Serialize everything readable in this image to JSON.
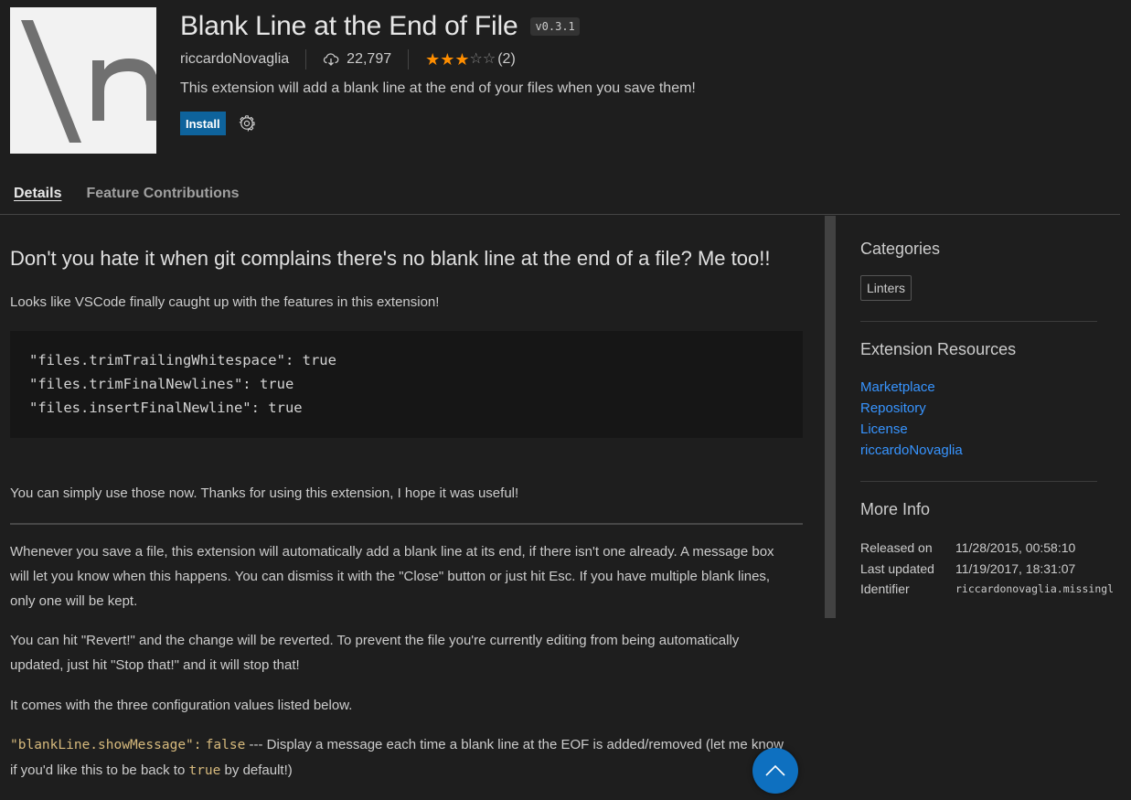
{
  "header": {
    "icon_text": "\\n",
    "title": "Blank Line at the End of File",
    "version": "v0.3.1",
    "publisher": "riccardoNovaglia",
    "install_count": "22,797",
    "rating": {
      "value": 3,
      "max": 5,
      "count_label": "(2)"
    },
    "description": "This extension will add a blank line at the end of your files when you save them!",
    "install_label": "Install",
    "icons": {
      "installs": "cloud-download-icon",
      "settings": "gear-icon",
      "star_full": "★",
      "star_empty": "☆"
    }
  },
  "tabs": [
    {
      "label": "Details",
      "active": true
    },
    {
      "label": "Feature Contributions",
      "active": false
    }
  ],
  "readme": {
    "heading": "Don't you hate it when git complains there's no blank line at the end of a file? Me too!!",
    "intro": "Looks like VSCode finally caught up with the features in this extension!",
    "code_lines": [
      "\"files.trimTrailingWhitespace\": true",
      "\"files.trimFinalNewlines\": true",
      "\"files.insertFinalNewline\": true"
    ],
    "use_now": "You can simply use those now. Thanks for using this extension, I hope it was useful!",
    "para1": "Whenever you save a file, this extension will automatically add a blank line at its end, if there isn't one already. A message box will let you know when this happens. You can dismiss it with the \"Close\" button or just hit Esc. If you have multiple blank lines, only one will be kept.",
    "para2": "You can hit \"Revert!\" and the change will be reverted. To prevent the file you're currently editing from being automatically updated, just hit \"Stop that!\" and it will stop that!",
    "para3": "It comes with the three configuration values listed below.",
    "config1": {
      "key": "\"blankLine.showMessage\":",
      "value": "false",
      "desc_before": " --- Display a message each time a blank line at the EOF is added/removed (let me know if you'd like this to be back to ",
      "desc_code": "true",
      "desc_after": " by default!)"
    }
  },
  "sidebar": {
    "categories": {
      "title": "Categories",
      "items": [
        "Linters"
      ]
    },
    "resources": {
      "title": "Extension Resources",
      "links": [
        "Marketplace",
        "Repository",
        "License",
        "riccardoNovaglia"
      ]
    },
    "more_info": {
      "title": "More Info",
      "rows": [
        {
          "label": "Released on",
          "value": "11/28/2015, 00:58:10"
        },
        {
          "label": "Last updated",
          "value": "11/19/2017, 18:31:07"
        },
        {
          "label": "Identifier",
          "value": "riccardonovaglia.missingl"
        }
      ]
    }
  },
  "colors": {
    "background": "#1e1e1e",
    "accent_button": "#0e639c",
    "link": "#3794ff",
    "star": "#ff8e00",
    "code_string": "#d7ba7d"
  }
}
